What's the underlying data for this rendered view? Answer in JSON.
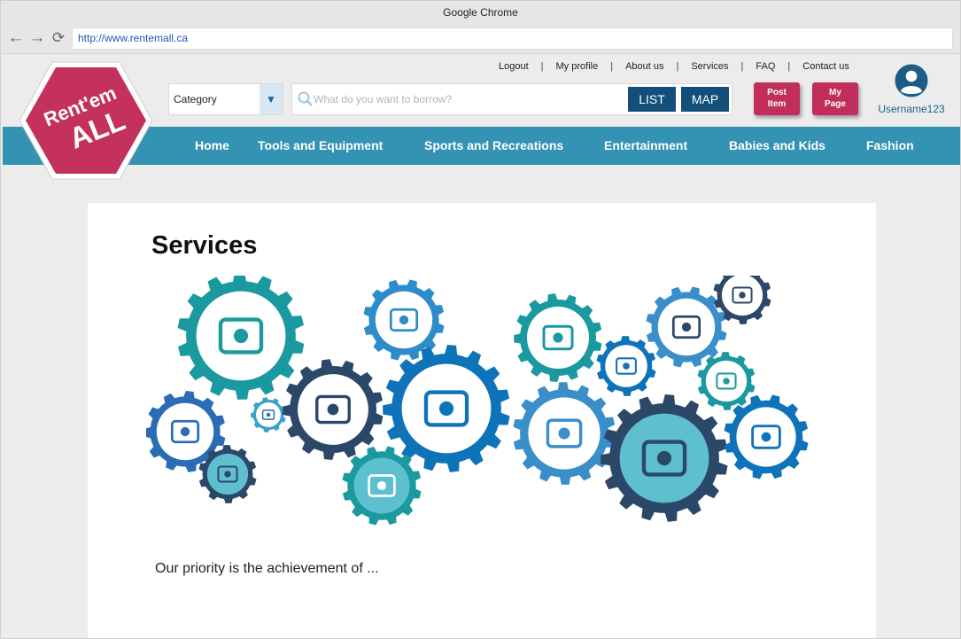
{
  "browser": {
    "title": "Google Chrome",
    "url": "http://www.rentemall.ca"
  },
  "header": {
    "logo": {
      "line1": "Rent'em",
      "line2": "ALL",
      "color": "#c4315d"
    },
    "toplinks": [
      "Logout",
      "My profile",
      "About us",
      "Services",
      "FAQ",
      "Contact us"
    ],
    "category_label": "Category",
    "search_placeholder": "What do you want to borrow?",
    "list_button": "LIST",
    "map_button": "MAP",
    "post_item": {
      "line1": "Post",
      "line2": "Item"
    },
    "my_page": {
      "line1": "My",
      "line2": "Page"
    },
    "username": "Username123"
  },
  "menu": {
    "items": [
      "Home",
      "Tools and Equipment",
      "Sports and Recreations",
      "Entertainment",
      "Babies and Kids",
      "Fashion"
    ],
    "color": "#3493b3"
  },
  "main": {
    "title": "Services",
    "illustration_icons": [
      "lightbulb-icon",
      "team-icon",
      "magnifier-icon",
      "tie-icon",
      "clipboard-icon",
      "bar-chart-icon",
      "target-icon",
      "pencil-icon",
      "calendar-icon",
      "money-icon",
      "pie-chart-icon",
      "trophy-icon",
      "briefcase-icon",
      "puzzle-icon",
      "handshake-icon",
      "megaphone-icon"
    ],
    "paragraph": "Our priority is the achievement of ..."
  }
}
